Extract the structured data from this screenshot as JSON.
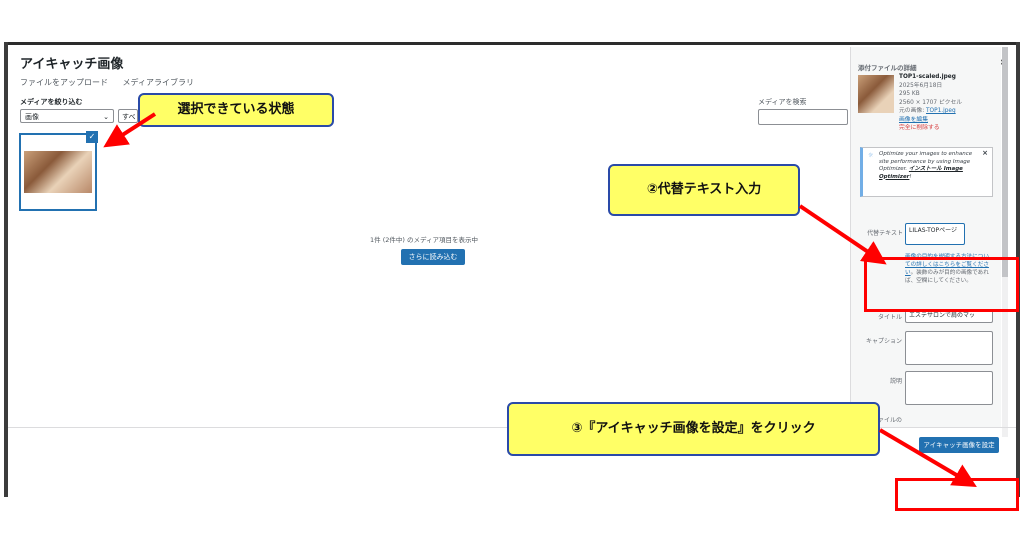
{
  "modal": {
    "title": "アイキャッチ画像",
    "close_label": "×",
    "tabs": [
      "ファイルをアップロード",
      "メディアライブラリ"
    ],
    "filter_label": "メディアを絞り込む",
    "filter_select": "画像",
    "filter_select2": "すべ",
    "search_label": "メディアを検索",
    "media_count": "1件 (2件中) のメディア項目を表示中",
    "load_more": "さらに読み込む",
    "set_button": "アイキャッチ画像を設定"
  },
  "details": {
    "heading": "添付ファイルの詳細",
    "filename": "TOP1-scaled.jpeg",
    "date": "2025年6月18日",
    "size": "295 KB",
    "dimensions": "2560 × 1707 ピクセル",
    "original_prefix": "元の画像:",
    "original_link": "TOP1.jpeg",
    "edit_link": "画像を編集",
    "delete_link": "完全に削除する"
  },
  "notice": {
    "text_before": "Optimize your images to enhance site performance by using Image Optimizer.",
    "link": "インストール Image Optimizer",
    "text_after": "!"
  },
  "fields": {
    "alt_label": "代替テキスト",
    "alt_value": "LILAS-TOPページ",
    "alt_help_link": "画像の目的を説明する方法についての詳しくはこちらをご覧ください",
    "alt_help_text": "。装飾のみが目的の画像であれば、空欄にしてください。",
    "title_label": "タイトル",
    "title_value": "エステサロンで肩のマッ",
    "caption_label": "キャプション",
    "description_label": "説明",
    "file_label": "ファイルの"
  },
  "callouts": {
    "selected": "選択できている状態",
    "alt": "②代替テキスト入力",
    "set": "③『アイキャッチ画像を設定』をクリック"
  },
  "colors": {
    "primary": "#2271b1",
    "callout_bg": "#ffff66",
    "callout_border": "#2a4aa8",
    "highlight_red": "#ff0000"
  }
}
